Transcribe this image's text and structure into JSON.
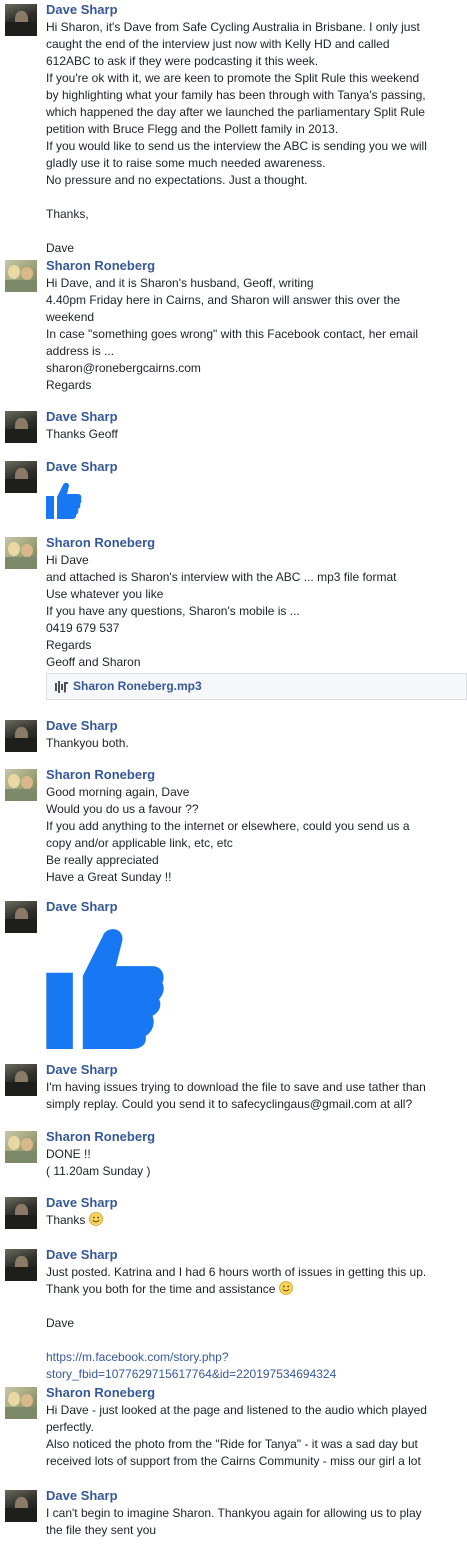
{
  "messages": [
    {
      "sender": "Dave Sharp",
      "lines": [
        "Hi Sharon, it's Dave from Safe Cycling Australia in Brisbane. I only just",
        "caught the end of the interview just now with Kelly HD and called",
        "612ABC to ask if they were podcasting it this week.",
        "If you're ok with it, we are keen to promote the Split Rule this weekend",
        "by highlighting what your family has been through with Tanya's passing,",
        "which happened the day after we launched the parliamentary Split Rule",
        "petition with Bruce Flegg and the Pollett family in 2013.",
        "If you would like to send us the interview the ABC is sending you we will",
        "gladly use it to raise some much needed awareness.",
        "No pressure and no expectations. Just a thought.",
        "",
        "Thanks,",
        "",
        "Dave"
      ]
    },
    {
      "sender": "Sharon Roneberg",
      "lines": [
        "Hi Dave, and it is Sharon's husband, Geoff, writing",
        "4.40pm Friday here in Cairns, and Sharon will answer this over the",
        "weekend",
        "In case \"something goes wrong\" with this Facebook contact, her email",
        "address is ...",
        "sharon@ronebergcairns.com",
        "Regards"
      ]
    },
    {
      "sender": "Dave Sharp",
      "lines": [
        "Thanks Geoff"
      ]
    },
    {
      "sender": "Dave Sharp",
      "sticker": "thumbs-up-icon"
    },
    {
      "sender": "Sharon Roneberg",
      "lines": [
        "Hi Dave",
        "and attached is Sharon's interview with the ABC ... mp3 file format",
        "Use whatever you like",
        "If you have any questions, Sharon's mobile is ...",
        "0419 679 537",
        "Regards",
        "Geoff and Sharon"
      ],
      "attachment": "Sharon Roneberg.mp3"
    },
    {
      "sender": "Dave Sharp",
      "lines": [
        "Thankyou both."
      ]
    },
    {
      "sender": "Sharon Roneberg",
      "lines": [
        "Good morning again, Dave",
        "Would you do us a favour ??",
        "If you add anything to the internet or elsewhere, could you send us a",
        "copy and/or applicable link, etc, etc",
        "Be really appreciated",
        "Have a Great Sunday !!"
      ]
    },
    {
      "sender": "Dave Sharp",
      "sticker": "large-thumbs-up-icon"
    },
    {
      "sender": "Dave Sharp",
      "lines": [
        "I'm having issues trying to download the file to save and use tather than",
        "simply replay. Could you send it to safecyclingaus@gmail.com at all?"
      ]
    },
    {
      "sender": "Sharon Roneberg",
      "lines": [
        "DONE !!",
        "( 11.20am Sunday )"
      ]
    },
    {
      "sender": "Dave Sharp",
      "lines": [
        "Thanks"
      ]
    },
    {
      "sender": "Dave Sharp",
      "lines": [
        "Just posted. Katrina and I had 6 hours worth of issues in getting this up.",
        "Thank you both for the time and assistance",
        "",
        "Dave",
        "",
        "https://m.facebook.com/story.php?",
        "story_fbid=1077629715617764&id=220197534694324"
      ]
    },
    {
      "sender": "Sharon Roneberg",
      "lines": [
        "Hi Dave - just looked at the page and listened to the audio which played",
        "perfectly.",
        "Also noticed the photo from the \"Ride for Tanya\" - it was a sad day but",
        "received lots of support from the Cairns Community - miss our girl a lot"
      ]
    },
    {
      "sender": "Dave Sharp",
      "lines": [
        "I can't begin to imagine Sharon. Thankyou again for allowing us to play",
        "the file they sent you"
      ]
    }
  ],
  "colors": {
    "name": "#365899",
    "text": "#1d2129",
    "like": "#1877f2"
  }
}
